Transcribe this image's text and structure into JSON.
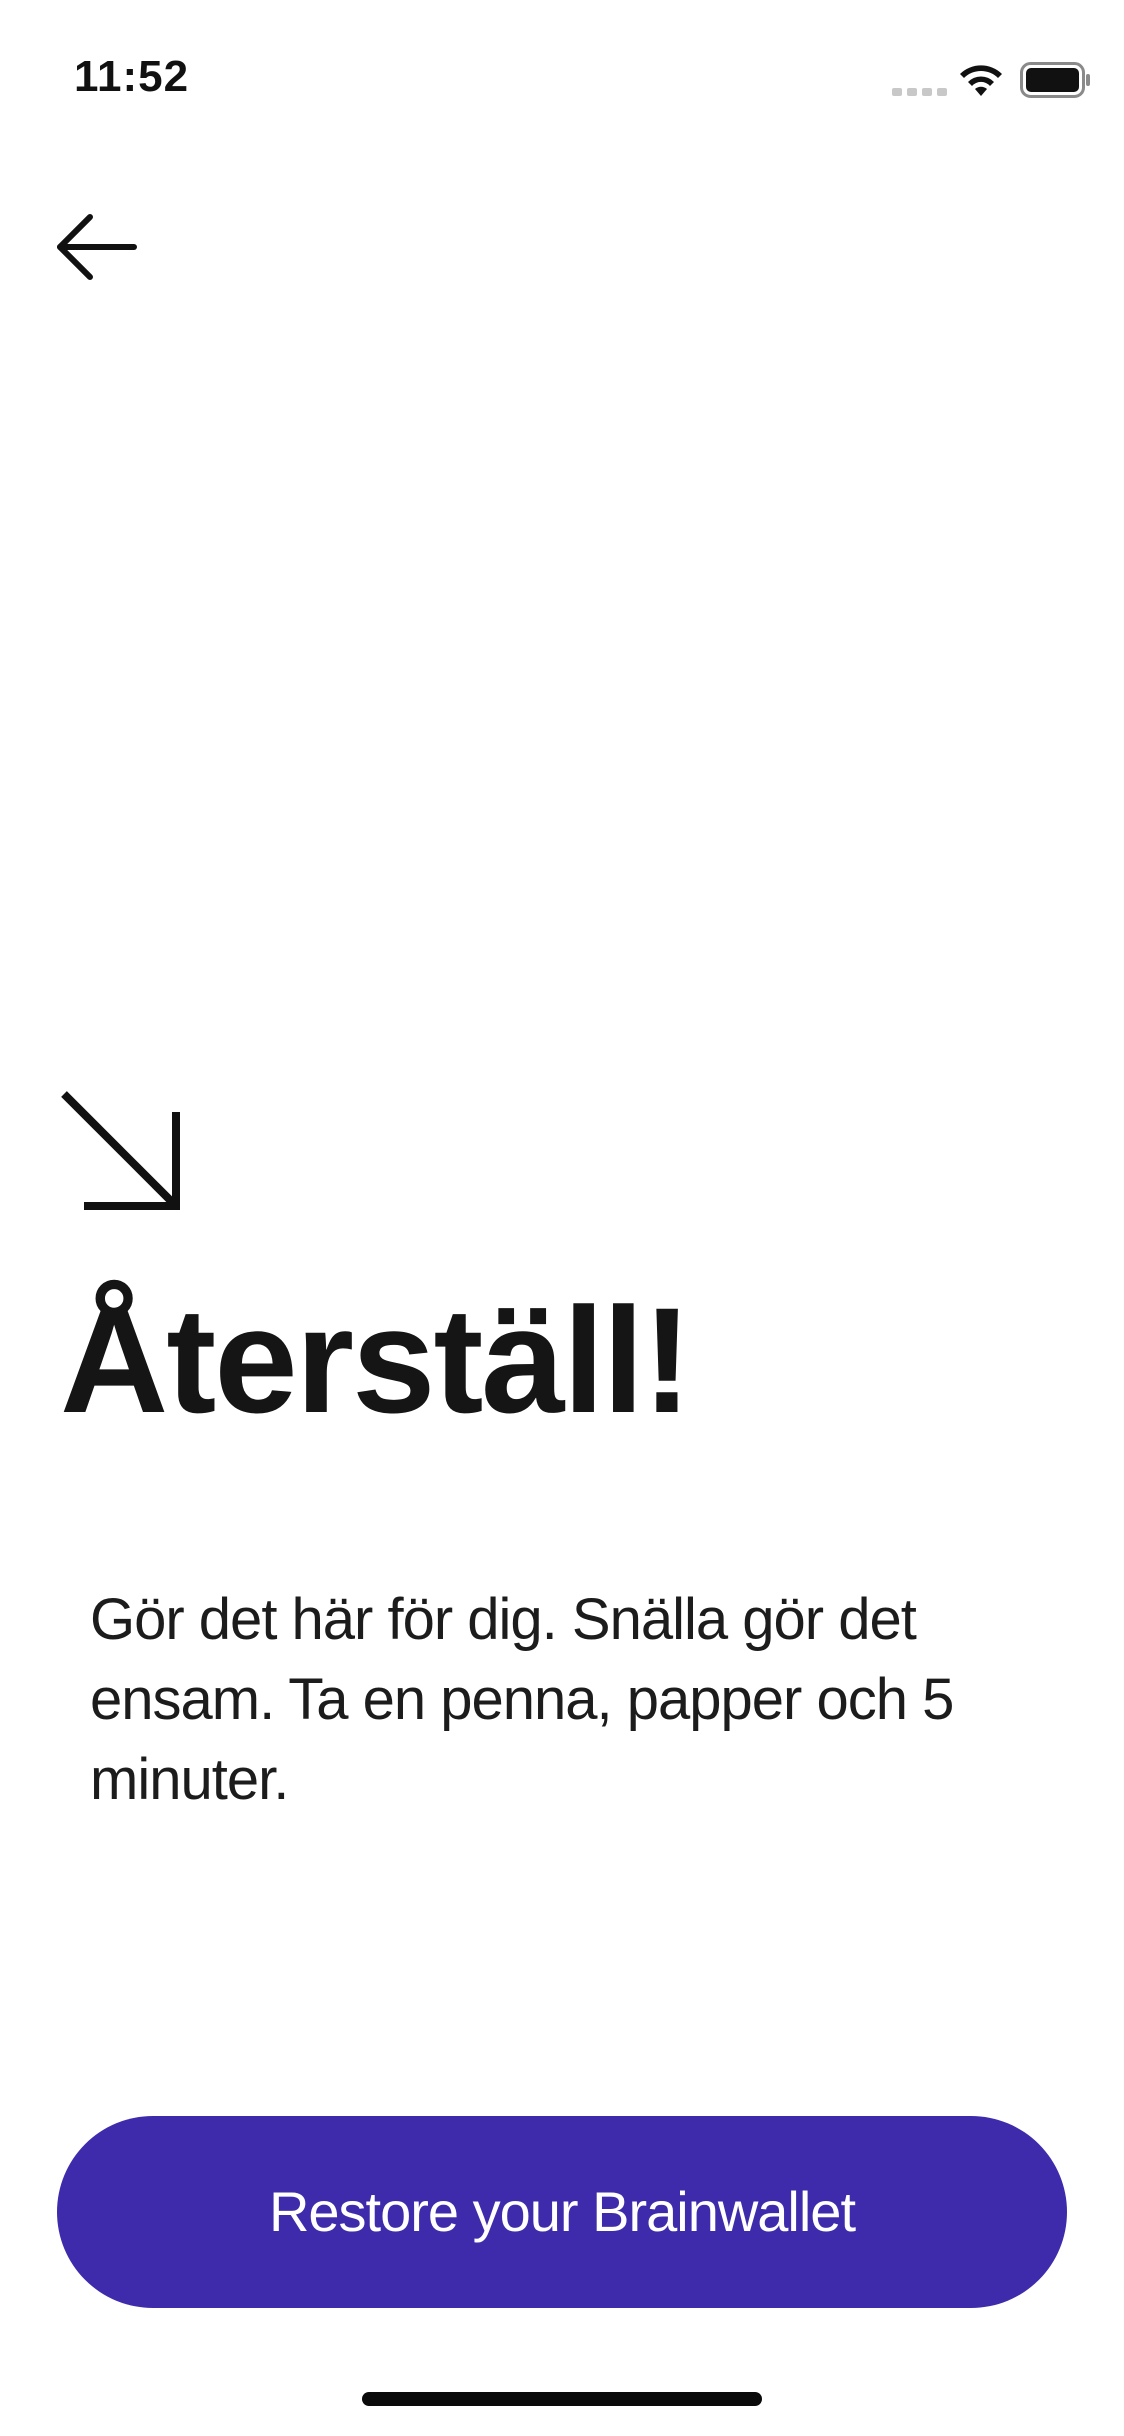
{
  "status_bar": {
    "time": "11:52"
  },
  "icons": {
    "back": "arrow-left-icon",
    "hero": "arrow-down-right-icon",
    "signal": "cellular-signal-icon",
    "wifi": "wifi-icon",
    "battery": "battery-icon"
  },
  "main": {
    "title": "Återställ!",
    "description": "Gör det här för dig. Snälla gör det ensam. Ta en penna, papper och 5 minuter."
  },
  "actions": {
    "restore_label": "Restore your Brainwallet"
  },
  "colors": {
    "accent": "#3d2bab",
    "background": "#ffffff",
    "text": "#111111"
  }
}
